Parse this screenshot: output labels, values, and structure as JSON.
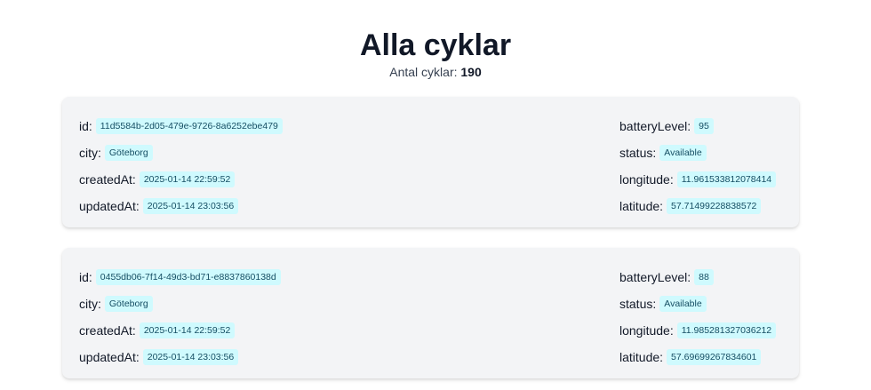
{
  "page": {
    "title": "Alla cyklar",
    "count_label": "Antal cyklar:",
    "count_value": "190"
  },
  "labels": {
    "id": "id:",
    "city": "city:",
    "createdAt": "createdAt:",
    "updatedAt": "updatedAt:",
    "batteryLevel": "batteryLevel:",
    "status": "status:",
    "longitude": "longitude:",
    "latitude": "latitude:"
  },
  "bikes": [
    {
      "id": "11d5584b-2d05-479e-9726-8a6252ebe479",
      "city": "Göteborg",
      "createdAt": "2025-01-14 22:59:52",
      "updatedAt": "2025-01-14 23:03:56",
      "batteryLevel": "95",
      "status": "Available",
      "longitude": "11.961533812078414",
      "latitude": "57.71499228838572"
    },
    {
      "id": "0455db06-7f14-49d3-bd71-e8837860138d",
      "city": "Göteborg",
      "createdAt": "2025-01-14 22:59:52",
      "updatedAt": "2025-01-14 23:03:56",
      "batteryLevel": "88",
      "status": "Available",
      "longitude": "11.985281327036212",
      "latitude": "57.69699267834601"
    }
  ],
  "colors": {
    "card_bg": "#f3f4f6",
    "badge_bg": "#cffafe",
    "badge_text": "#164e63"
  }
}
